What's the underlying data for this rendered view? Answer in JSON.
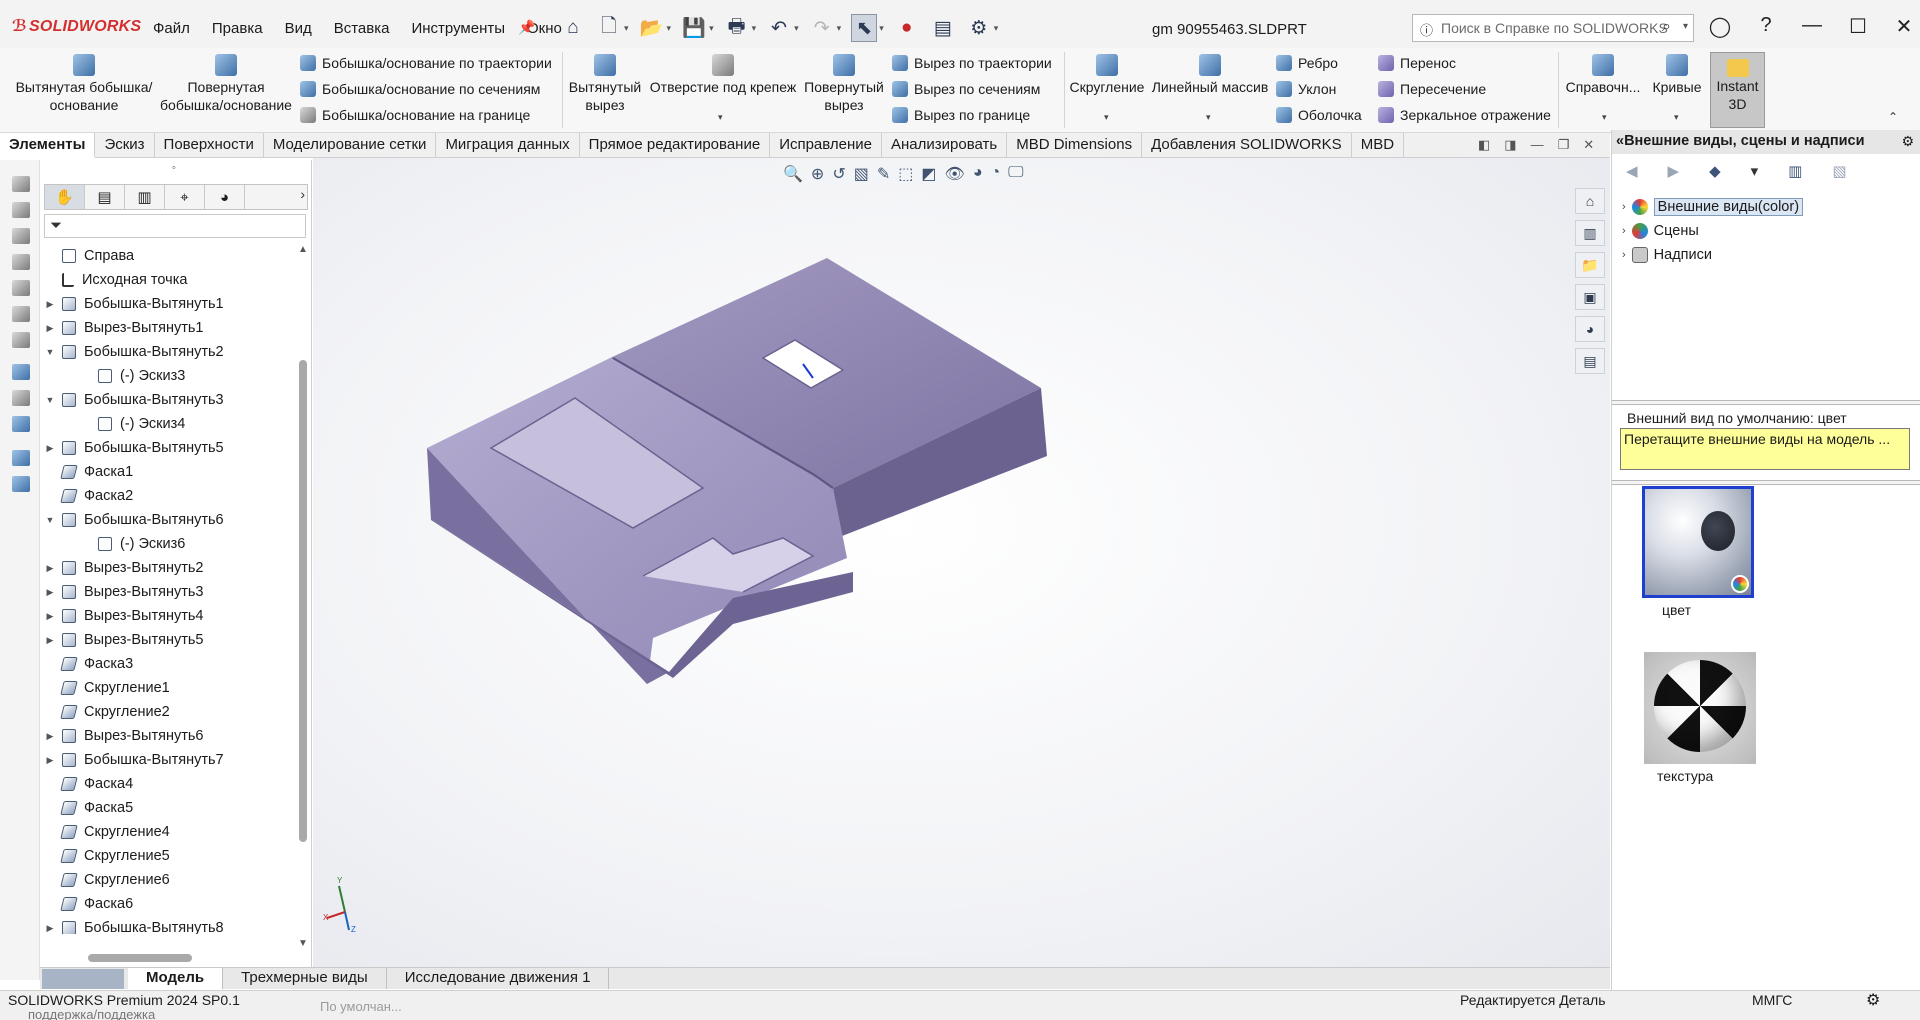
{
  "app": {
    "logo": "SOLIDWORKS",
    "doc_title": "gm 90955463.SLDPRT",
    "menu": [
      "Файл",
      "Правка",
      "Вид",
      "Вставка",
      "Инструменты",
      "Окно"
    ],
    "search_placeholder": "Поиск в Справке по SOLIDWORKS"
  },
  "ribbon": {
    "extrude_boss": "Вытянутая бобышка/основание",
    "revolve_boss": "Повернутая бобышка/основание",
    "sweep_boss": "Бобышка/основание по траектории",
    "loft_boss": "Бобышка/основание по сечениям",
    "boundary_boss": "Бобышка/основание на границе",
    "extrude_cut": "Вытянутый вырез",
    "hole_wizard": "Отверстие под крепеж",
    "revolve_cut": "Повернутый вырез",
    "sweep_cut": "Вырез по траектории",
    "loft_cut": "Вырез по сечениям",
    "boundary_cut": "Вырез по границе",
    "fillet": "Скругление",
    "linear_pattern": "Линейный массив",
    "rib": "Ребро",
    "draft": "Уклон",
    "shell": "Оболочка",
    "wrap": "Перенос",
    "intersect": "Пересечение",
    "mirror": "Зеркальное отражение",
    "ref_geometry": "Справочн...",
    "curves": "Кривые",
    "instant3d": "Instant 3D"
  },
  "tabs": [
    "Элементы",
    "Эскиз",
    "Поверхности",
    "Моделирование сетки",
    "Миграция данных",
    "Прямое редактирование",
    "Исправление",
    "Анализировать",
    "MBD Dimensions",
    "Добавления SOLIDWORKS",
    "MBD"
  ],
  "feature_tree": [
    {
      "label": "Справа",
      "icon": "plane-icon",
      "indent": 0,
      "twisty": ""
    },
    {
      "label": "Исходная точка",
      "icon": "origin-icon",
      "indent": 0,
      "twisty": ""
    },
    {
      "label": "Бобышка-Вытянуть1",
      "icon": "extrude-icon",
      "indent": 0,
      "twisty": "▶"
    },
    {
      "label": "Вырез-Вытянуть1",
      "icon": "cut-icon",
      "indent": 0,
      "twisty": "▶"
    },
    {
      "label": "Бобышка-Вытянуть2",
      "icon": "extrude-icon",
      "indent": 0,
      "twisty": "▼"
    },
    {
      "label": "(-) Эскиз3",
      "icon": "sketch-icon",
      "indent": 1,
      "twisty": ""
    },
    {
      "label": "Бобышка-Вытянуть3",
      "icon": "extrude-icon",
      "indent": 0,
      "twisty": "▼"
    },
    {
      "label": "(-) Эскиз4",
      "icon": "sketch-icon",
      "indent": 1,
      "twisty": ""
    },
    {
      "label": "Бобышка-Вытянуть5",
      "icon": "extrude-icon",
      "indent": 0,
      "twisty": "▶"
    },
    {
      "label": "Фаска1",
      "icon": "chamfer-icon",
      "indent": 0,
      "twisty": ""
    },
    {
      "label": "Фаска2",
      "icon": "chamfer-icon",
      "indent": 0,
      "twisty": ""
    },
    {
      "label": "Бобышка-Вытянуть6",
      "icon": "extrude-icon",
      "indent": 0,
      "twisty": "▼"
    },
    {
      "label": "(-) Эскиз6",
      "icon": "sketch-icon",
      "indent": 1,
      "twisty": ""
    },
    {
      "label": "Вырез-Вытянуть2",
      "icon": "cut-icon",
      "indent": 0,
      "twisty": "▶"
    },
    {
      "label": "Вырез-Вытянуть3",
      "icon": "cut-icon",
      "indent": 0,
      "twisty": "▶"
    },
    {
      "label": "Вырез-Вытянуть4",
      "icon": "cut-icon",
      "indent": 0,
      "twisty": "▶"
    },
    {
      "label": "Вырез-Вытянуть5",
      "icon": "cut-icon",
      "indent": 0,
      "twisty": "▶"
    },
    {
      "label": "Фаска3",
      "icon": "chamfer-icon",
      "indent": 0,
      "twisty": ""
    },
    {
      "label": "Скругление1",
      "icon": "fillet-icon",
      "indent": 0,
      "twisty": ""
    },
    {
      "label": "Скругление2",
      "icon": "fillet-icon",
      "indent": 0,
      "twisty": ""
    },
    {
      "label": "Вырез-Вытянуть6",
      "icon": "cut-icon",
      "indent": 0,
      "twisty": "▶"
    },
    {
      "label": "Бобышка-Вытянуть7",
      "icon": "extrude-icon",
      "indent": 0,
      "twisty": "▶"
    },
    {
      "label": "Фаска4",
      "icon": "chamfer-icon",
      "indent": 0,
      "twisty": ""
    },
    {
      "label": "Фаска5",
      "icon": "chamfer-icon",
      "indent": 0,
      "twisty": ""
    },
    {
      "label": "Скругление4",
      "icon": "fillet-icon",
      "indent": 0,
      "twisty": ""
    },
    {
      "label": "Скругление5",
      "icon": "fillet-icon",
      "indent": 0,
      "twisty": ""
    },
    {
      "label": "Скругление6",
      "icon": "fillet-icon",
      "indent": 0,
      "twisty": ""
    },
    {
      "label": "Фаска6",
      "icon": "chamfer-icon",
      "indent": 0,
      "twisty": ""
    },
    {
      "label": "Бобышка-Вытянуть8",
      "icon": "extrude-icon",
      "indent": 0,
      "twisty": "▶"
    }
  ],
  "bottom_tabs": [
    "Модель",
    "Трехмерные виды",
    "Исследование движения 1"
  ],
  "status": {
    "product": "SOLIDWORKS Premium 2024 SP0.1",
    "under_text": "поддержка/поддежка",
    "under_text2": "По умолчан...",
    "mode": "Редактируется Деталь",
    "units": "ММГС"
  },
  "task_pane": {
    "title": "Внешние виды, сцены и надписи",
    "items": [
      "Внешние виды(color)",
      "Сцены",
      "Надписи"
    ],
    "default_label": "Внешний вид по умолчанию: цвет",
    "hint": "Перетащите внешние виды на модель ...",
    "thumb1_label": "цвет",
    "thumb2_label": "текстура"
  },
  "triad": {
    "x": "X",
    "y": "Y",
    "z": "Z"
  },
  "colors": {
    "model": "#8f85b0",
    "accent": "#1f3fd1",
    "logo": "#d32f2f"
  }
}
